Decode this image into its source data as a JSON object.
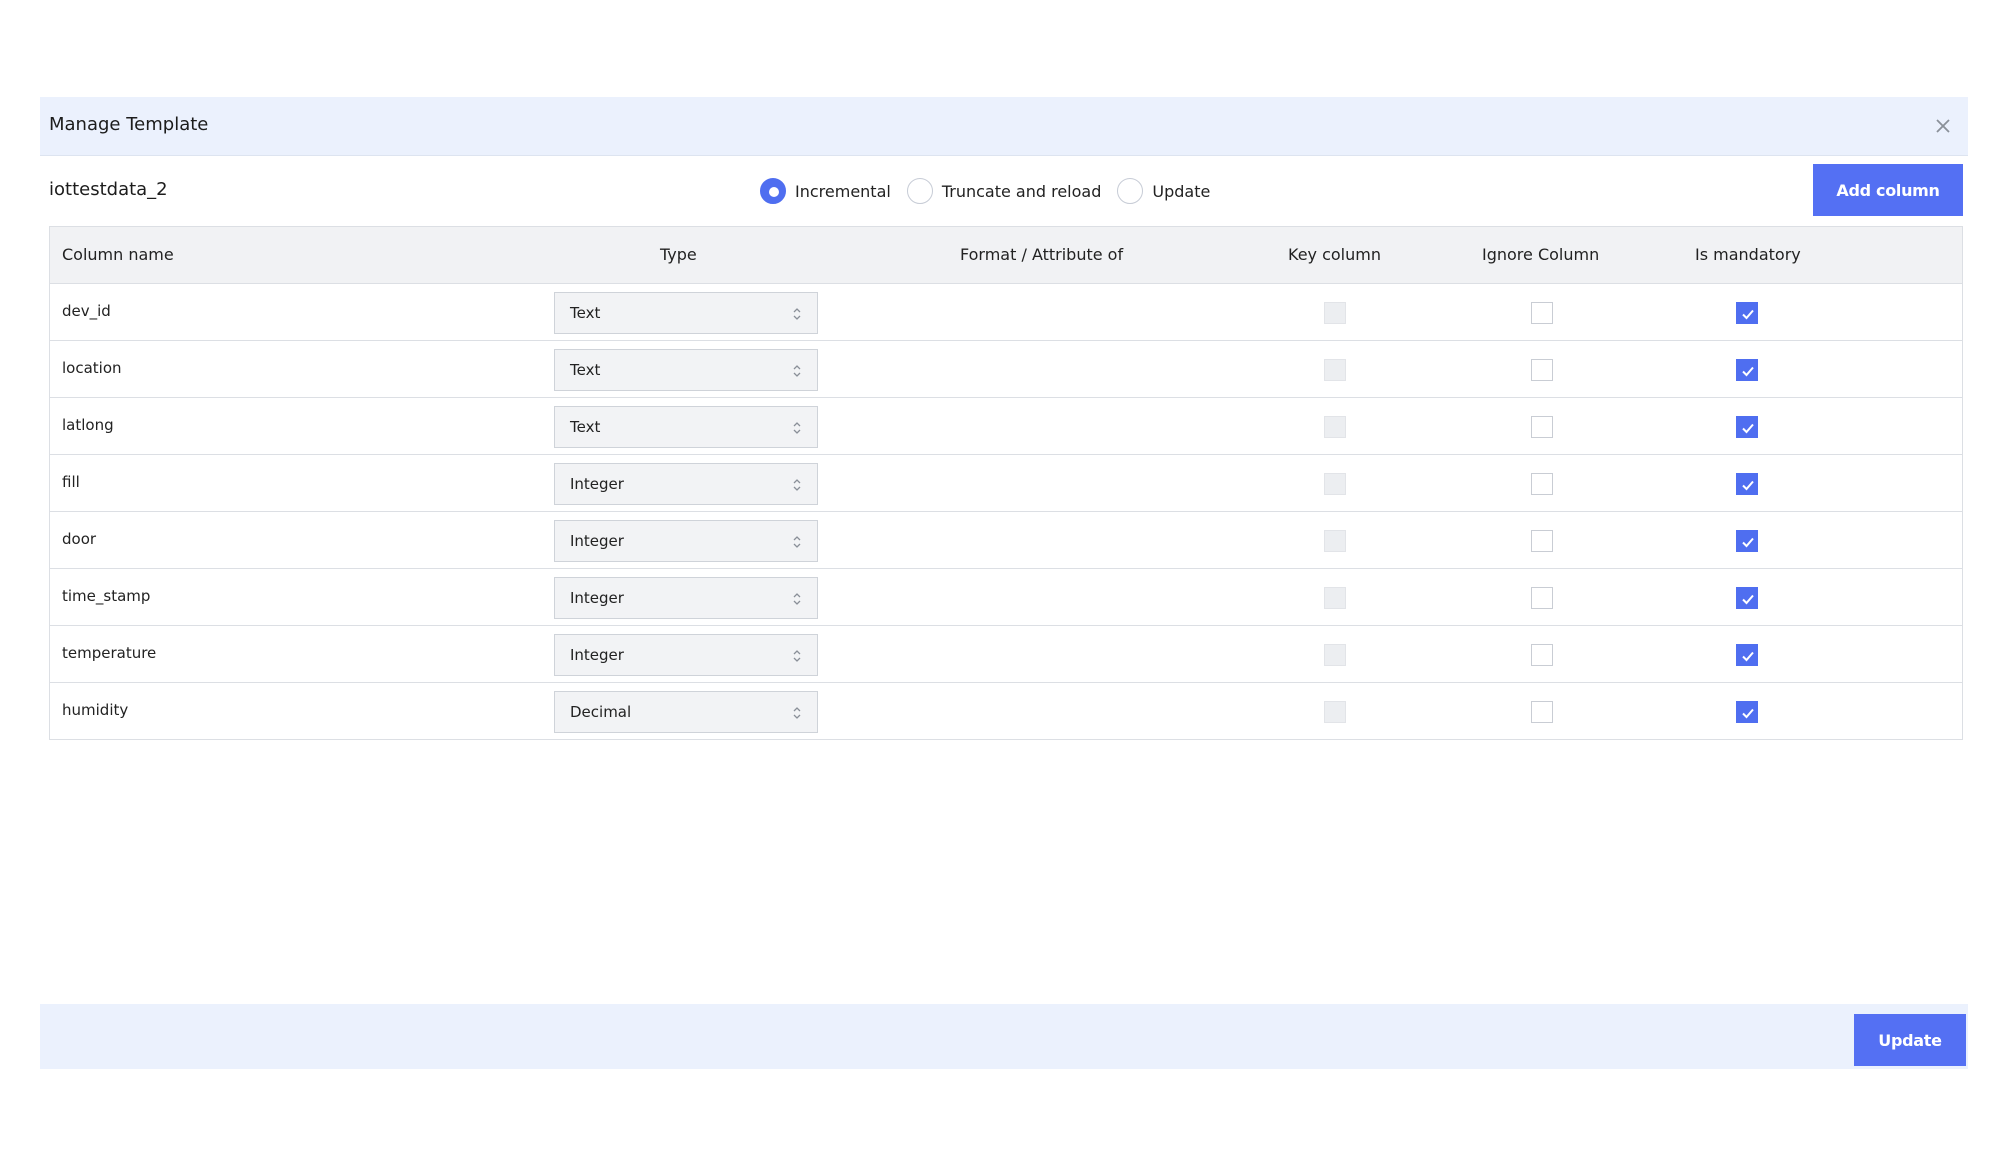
{
  "modal": {
    "title": "Manage Template",
    "close_icon": "close-icon"
  },
  "toolbar": {
    "template_name": "iottestdata_2",
    "load_modes": [
      {
        "label": "Incremental",
        "checked": true
      },
      {
        "label": "Truncate and reload",
        "checked": false
      },
      {
        "label": "Update",
        "checked": false
      }
    ],
    "add_column_label": "Add column"
  },
  "grid": {
    "headers": {
      "column_name": "Column name",
      "type": "Type",
      "format": "Format / Attribute of",
      "key_column": "Key column",
      "ignore_column": "Ignore Column",
      "is_mandatory": "Is mandatory"
    },
    "rows": [
      {
        "name": "dev_id",
        "type": "Text",
        "format": "",
        "key_column": false,
        "key_disabled": true,
        "ignore": false,
        "mandatory": true
      },
      {
        "name": "location",
        "type": "Text",
        "format": "",
        "key_column": false,
        "key_disabled": true,
        "ignore": false,
        "mandatory": true
      },
      {
        "name": "latlong",
        "type": "Text",
        "format": "",
        "key_column": false,
        "key_disabled": true,
        "ignore": false,
        "mandatory": true
      },
      {
        "name": "fill",
        "type": "Integer",
        "format": "",
        "key_column": false,
        "key_disabled": true,
        "ignore": false,
        "mandatory": true
      },
      {
        "name": "door",
        "type": "Integer",
        "format": "",
        "key_column": false,
        "key_disabled": true,
        "ignore": false,
        "mandatory": true
      },
      {
        "name": "time_stamp",
        "type": "Integer",
        "format": "",
        "key_column": false,
        "key_disabled": true,
        "ignore": false,
        "mandatory": true
      },
      {
        "name": "temperature",
        "type": "Integer",
        "format": "",
        "key_column": false,
        "key_disabled": true,
        "ignore": false,
        "mandatory": true
      },
      {
        "name": "humidity",
        "type": "Decimal",
        "format": "",
        "key_column": false,
        "key_disabled": true,
        "ignore": false,
        "mandatory": true
      }
    ]
  },
  "footer": {
    "update_label": "Update"
  },
  "colors": {
    "accent": "#5470f3",
    "header_bg": "#ebf1fd",
    "grid_header_bg": "#f1f2f4"
  }
}
